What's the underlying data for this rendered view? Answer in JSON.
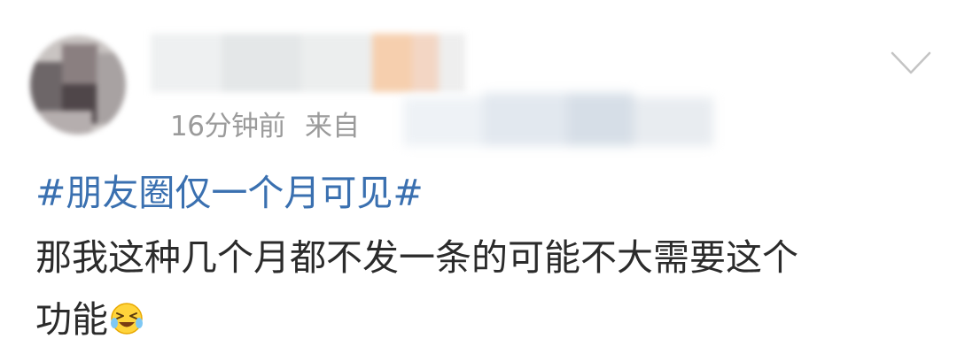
{
  "post": {
    "timestamp": "16分钟前",
    "source_prefix": "来自",
    "topic": "#朋友圈仅一个月可见#",
    "body_line1": "那我这种几个月都不发一条的可能不大需要这个",
    "body_line2": "功能",
    "emoji_icon": "laughing-crying-emoji-icon",
    "menu_icon": "chevron-down-icon"
  },
  "colors": {
    "topic_link": "#3a70b0",
    "meta_text": "#9b9b9b",
    "body_text": "#2b2b2b"
  }
}
